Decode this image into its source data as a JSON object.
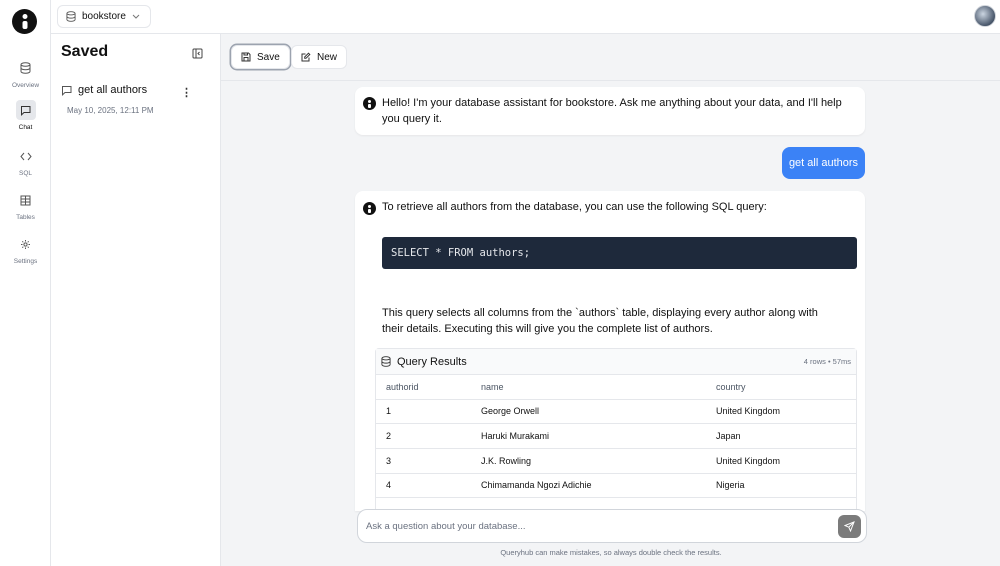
{
  "app": {
    "database": "bookstore"
  },
  "nav": {
    "items": [
      {
        "label": "Overview",
        "icon": "database-icon",
        "active": false
      },
      {
        "label": "Chat",
        "icon": "chat-icon",
        "active": true
      },
      {
        "label": "SQL",
        "icon": "code-icon",
        "active": false
      },
      {
        "label": "Tables",
        "icon": "table-icon",
        "active": false
      },
      {
        "label": "Settings",
        "icon": "gear-icon",
        "active": false
      }
    ]
  },
  "saved": {
    "title": "Saved",
    "items": [
      {
        "title": "get all authors",
        "date": "May 10, 2025, 12:11 PM"
      }
    ]
  },
  "toolbar": {
    "save_label": "Save",
    "new_label": "New"
  },
  "chat": {
    "greeting": "Hello! I'm your database assistant for bookstore. Ask me anything about your data, and I'll help you query it.",
    "user_message": "get all authors",
    "response_intro": "To retrieve all authors from the database, you can use the following SQL query:",
    "sql": "SELECT * FROM authors;",
    "response_explanation": "This query selects all columns from the `authors` table, displaying every author along with their details.  Executing this will give you the complete list of authors."
  },
  "results": {
    "title": "Query Results",
    "meta": "4 rows • 57ms",
    "columns": [
      "authorid",
      "name",
      "country"
    ],
    "rows": [
      [
        "1",
        "George Orwell",
        "United Kingdom"
      ],
      [
        "2",
        "Haruki Murakami",
        "Japan"
      ],
      [
        "3",
        "J.K. Rowling",
        "United Kingdom"
      ],
      [
        "4",
        "Chimamanda Ngozi Adichie",
        "Nigeria"
      ]
    ]
  },
  "input": {
    "placeholder": "Ask a question about your database..."
  },
  "footer": {
    "disclaimer": "Queryhub can make mistakes, so always double check the results."
  },
  "colors": {
    "accent": "#3b82f6",
    "code_bg": "#1e293b",
    "send_button": "#7b7b7b"
  }
}
